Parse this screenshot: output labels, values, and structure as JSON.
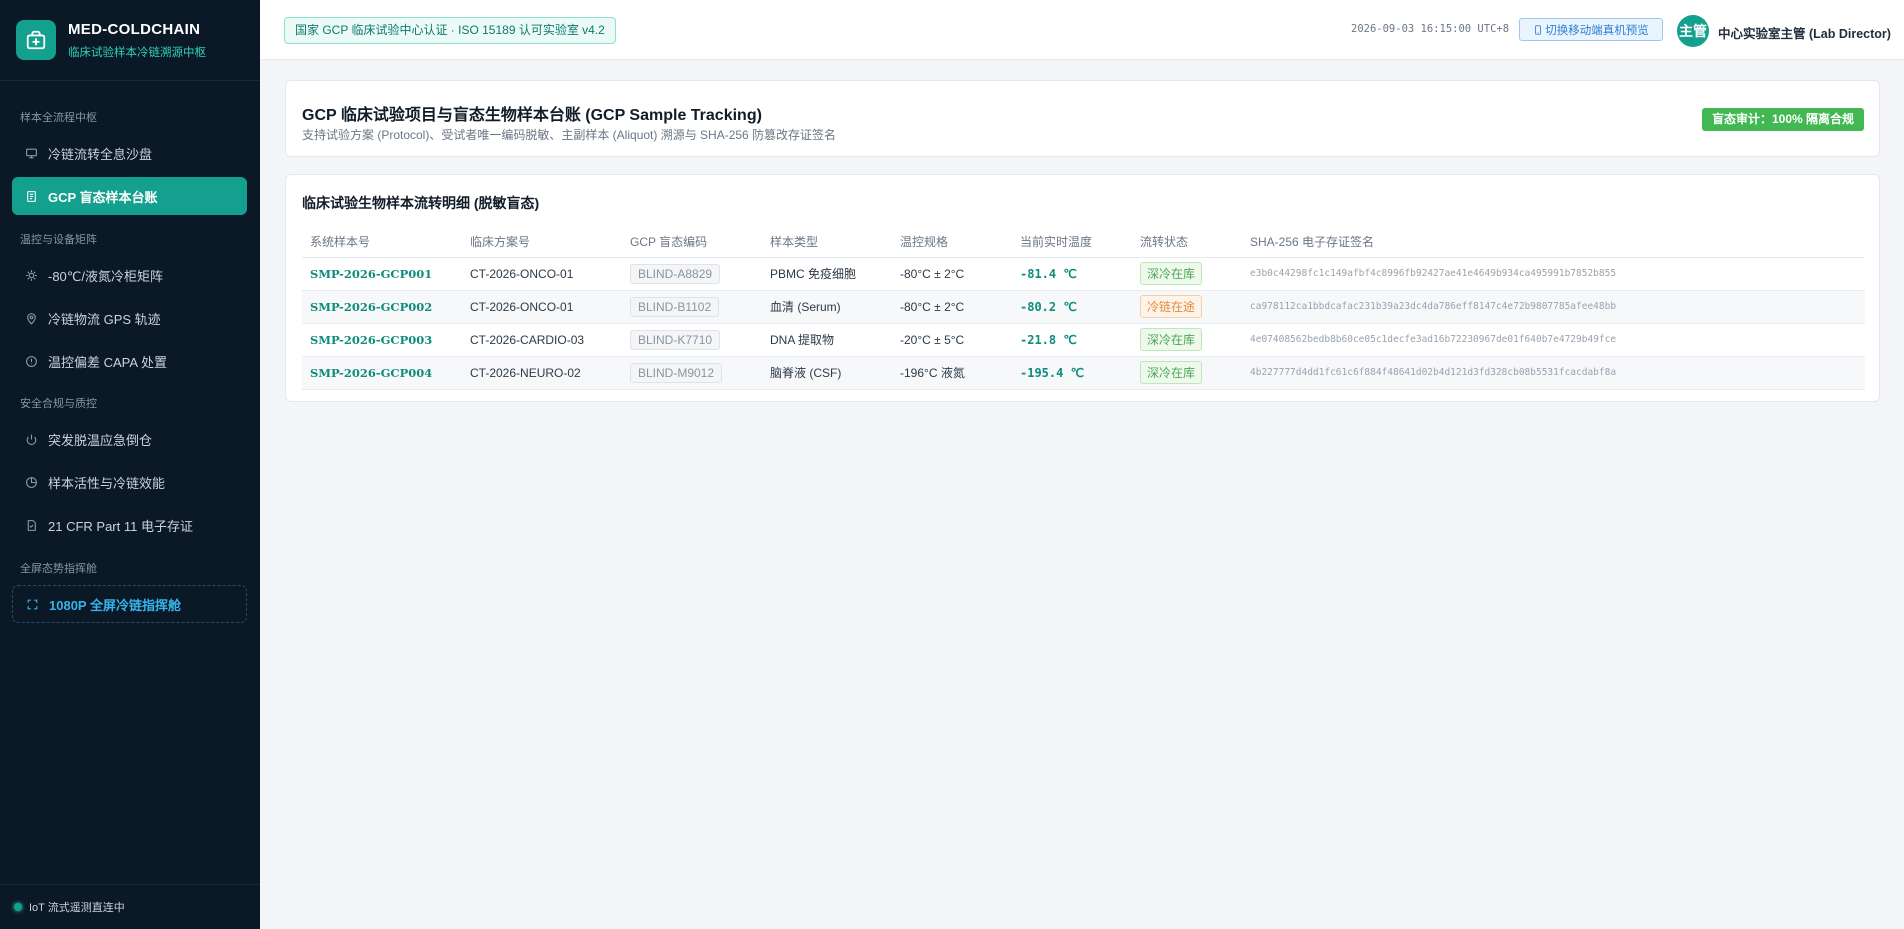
{
  "brand": {
    "name": "MED-COLDCHAIN",
    "subtitle": "临床试验样本冷链溯源中枢"
  },
  "sidebar": {
    "groups": [
      {
        "title": "样本全流程中枢",
        "items": [
          {
            "label": "冷链流转全息沙盘",
            "icon": "monitor-icon"
          },
          {
            "label": "GCP 盲态样本台账",
            "icon": "document-icon",
            "active": true
          }
        ]
      },
      {
        "title": "温控与设备矩阵",
        "items": [
          {
            "label": "-80℃/液氮冷柜矩阵",
            "icon": "cpu-icon"
          },
          {
            "label": "冷链物流 GPS 轨迹",
            "icon": "map-pin-icon"
          },
          {
            "label": "温控偏差 CAPA 处置",
            "icon": "alert-circle-icon"
          }
        ]
      },
      {
        "title": "安全合规与质控",
        "items": [
          {
            "label": "突发脱温应急倒仓",
            "icon": "power-icon"
          },
          {
            "label": "样本活性与冷链效能",
            "icon": "pie-chart-icon"
          },
          {
            "label": "21 CFR Part 11 电子存证",
            "icon": "file-check-icon"
          }
        ]
      },
      {
        "title": "全屏态势指挥舱",
        "items": [
          {
            "label": "1080P 全屏冷链指挥舱",
            "icon": "fullscreen-icon"
          }
        ]
      }
    ],
    "footer": "IoT 流式遥测直连中"
  },
  "header": {
    "cert_badge": "国家 GCP 临床试验中心认证 · ISO 15189 认可实验室 v4.2",
    "clock": "2026-09-03 16:15:00 UTC+8",
    "mobile_button": "切换移动端真机预览",
    "avatar": "主管",
    "user": "中心实验室主管 (Lab Director)"
  },
  "overview": {
    "title": "GCP 临床试验项目与盲态生物样本台账 (GCP Sample Tracking)",
    "subtitle": "支持试验方案 (Protocol)、受试者唯一编码脱敏、主副样本 (Aliquot) 溯源与 SHA-256 防篡改存证签名",
    "audit_badge": "盲态审计：100% 隔离合规"
  },
  "detail": {
    "title": "临床试验生物样本流转明细 (脱敏盲态)",
    "columns": [
      "系统样本号",
      "临床方案号",
      "GCP 盲态编码",
      "样本类型",
      "温控规格",
      "当前实时温度",
      "流转状态",
      "SHA-256 电子存证签名"
    ],
    "rows": [
      {
        "id": "SMP-2026-GCP001",
        "protocol": "CT-2026-ONCO-01",
        "blind": "BLIND-A8829",
        "type": "PBMC 免疫细胞",
        "spec": "-80°C ± 2°C",
        "temp": "-81.4 ℃",
        "status": "深冷在库",
        "status_kind": "ok",
        "sha": "e3b0c44298fc1c149afbf4c8996fb92427ae41e4649b934ca495991b7852b855"
      },
      {
        "id": "SMP-2026-GCP002",
        "protocol": "CT-2026-ONCO-01",
        "blind": "BLIND-B1102",
        "type": "血清 (Serum)",
        "spec": "-80°C ± 2°C",
        "temp": "-80.2 ℃",
        "status": "冷链在途",
        "status_kind": "transit",
        "sha": "ca978112ca1bbdcafac231b39a23dc4da786eff8147c4e72b9807785afee48bb"
      },
      {
        "id": "SMP-2026-GCP003",
        "protocol": "CT-2026-CARDIO-03",
        "blind": "BLIND-K7710",
        "type": "DNA 提取物",
        "spec": "-20°C ± 5°C",
        "temp": "-21.8 ℃",
        "status": "深冷在库",
        "status_kind": "ok",
        "sha": "4e07408562bedb8b60ce05c1decfe3ad16b72230967de01f640b7e4729b49fce"
      },
      {
        "id": "SMP-2026-GCP004",
        "protocol": "CT-2026-NEURO-02",
        "blind": "BLIND-M9012",
        "type": "脑脊液 (CSF)",
        "spec": "-196°C 液氮",
        "temp": "-195.4 ℃",
        "status": "深冷在库",
        "status_kind": "ok",
        "sha": "4b227777d4dd1fc61c6f884f48641d02b4d121d3fd328cb08b5531fcacdabf8a"
      }
    ]
  },
  "colors": {
    "accent": "#14a08e",
    "sidebar_bg": "#0b1826",
    "ok": "#4aa757",
    "transit": "#e58a3a",
    "audit": "#41b852"
  }
}
